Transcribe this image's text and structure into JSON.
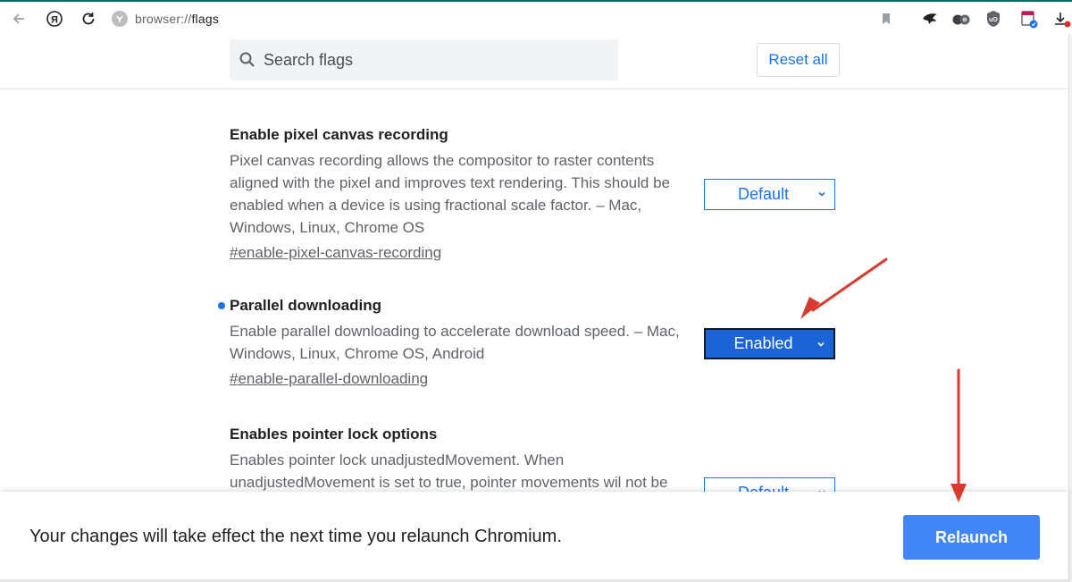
{
  "browser": {
    "url_scheme": "browser://",
    "url_path": "flags",
    "toolbar_icons": [
      "back-icon",
      "yandex-logo-icon",
      "reload-icon",
      "site-info-icon",
      "bookmark-icon",
      "extension-bird-icon",
      "extension-glasses-icon",
      "ublock-origin-icon",
      "extension-calendar-icon",
      "download-icon"
    ]
  },
  "header": {
    "search_placeholder": "Search flags",
    "reset_all_label": "Reset all"
  },
  "flags": [
    {
      "title": "Enable pixel canvas recording",
      "description": "Pixel canvas recording allows the compositor to raster contents aligned with the pixel and improves text rendering. This should be enabled when a device is using fractional scale factor. – Mac, Windows, Linux, Chrome OS",
      "link": "#enable-pixel-canvas-recording",
      "value": "Default",
      "modified": false
    },
    {
      "title": "Parallel downloading",
      "description": "Enable parallel downloading to accelerate download speed. – Mac, Windows, Linux, Chrome OS, Android",
      "link": "#enable-parallel-downloading",
      "value": "Enabled",
      "modified": true
    },
    {
      "title": "Enables pointer lock options",
      "description": "Enables pointer lock unadjustedMovement. When unadjustedMovement is set to true, pointer movements wil not be",
      "link": "",
      "value": "Default",
      "modified": false
    }
  ],
  "footer": {
    "message": "Your changes will take effect the next time you relaunch Chromium.",
    "relaunch_label": "Relaunch"
  },
  "colors": {
    "accent": "#1a73e8",
    "relaunch_button": "#4285f4",
    "enabled_select": "#1a64d6",
    "annotation_arrow": "#d93a30"
  }
}
